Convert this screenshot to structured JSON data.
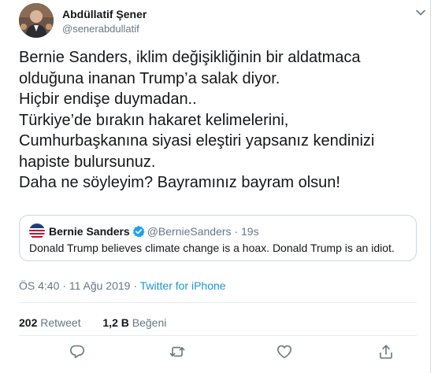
{
  "author": {
    "display_name": "Abdüllatif Şener",
    "handle": "@senerabdullatif"
  },
  "tweet": {
    "text": "Bernie Sanders, iklim değişikliğinin bir aldatmaca\nolduğuna inanan Trump’a salak diyor.\nHiçbir endişe duymadan..\nTürkiye’de bırakın hakaret kelimelerini,\nCumhurbaşkanına siyasi eleştiri yapsanız kendinizi\nhapiste bulursunuz.\nDaha ne söyleyim? Bayramınız bayram olsun!"
  },
  "quoted": {
    "name": "Bernie Sanders",
    "handle": "@BernieSanders",
    "separator": "·",
    "time": "19s",
    "text": "Donald Trump believes climate change is a hoax. Donald Trump is an idiot."
  },
  "meta": {
    "time": "ÖS 4:40",
    "sep1": "·",
    "date": "11 Ağu 2019",
    "sep2": "·",
    "source": "Twitter for iPhone"
  },
  "stats": {
    "retweets_count": "202",
    "retweets_label": "Retweet",
    "likes_count": "1,2 B",
    "likes_label": "Beğeni"
  },
  "icons": {
    "menu": "chevron-down-icon",
    "reply": "reply-icon",
    "retweet": "retweet-icon",
    "like": "heart-icon",
    "share": "share-icon",
    "verified": "verified-badge-icon"
  },
  "colors": {
    "link": "#1b95e0",
    "secondary_text": "#657786",
    "verified": "#1da1f2",
    "border": "#ccd6dd"
  }
}
